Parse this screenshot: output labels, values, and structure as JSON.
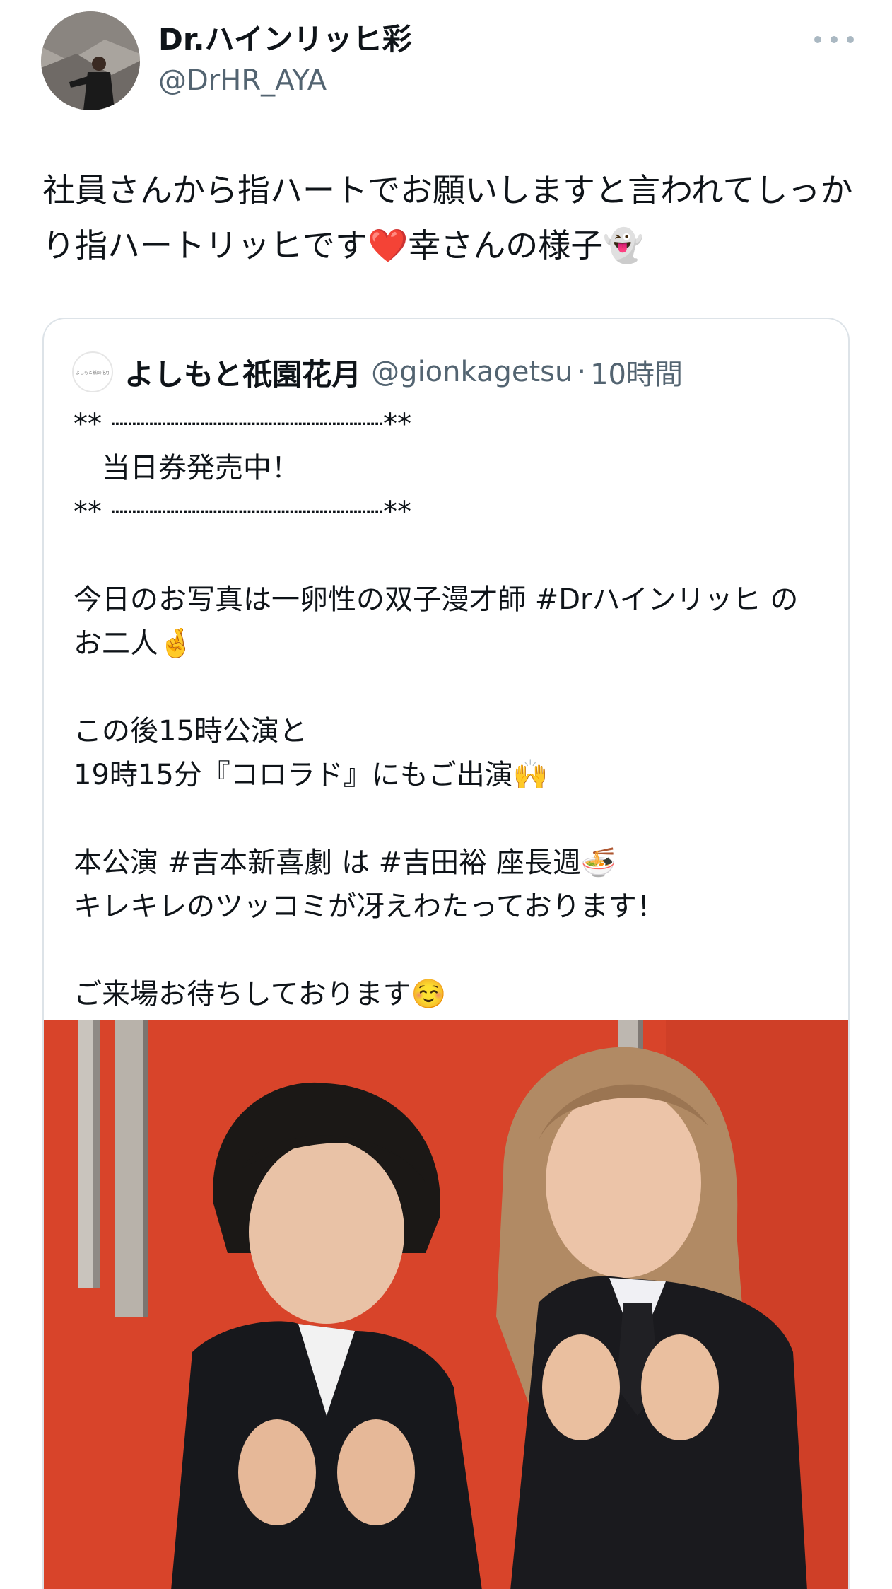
{
  "tweet": {
    "author_name": "Dr.ハインリッヒ彩",
    "author_handle": "@DrHR_AYA",
    "text": "社員さんから指ハートでお願いしますと言われてしっかり指ハートリッヒです❤️幸さんの様子👻"
  },
  "quote": {
    "avatar_text": "よしもと祇園花月",
    "author_name": "よしもと祇園花月",
    "author_handle": "@gionkagetsu",
    "separator": "·",
    "time": "10時間",
    "text": "** ┈┈┈┈┈┈┈┈┈┈┈┈┈┈┈┈**\n　当日券発売中！\n** ┈┈┈┈┈┈┈┈┈┈┈┈┈┈┈┈**\n\n今日のお写真は一卵性の双子漫才師 #Drハインリッヒ のお二人🤞\n\nこの後15時公演と\n19時15分『コロラド』にもご出演🙌\n\n本公演 #吉本新喜劇 は #吉田裕 座長週🍜\nキレキレのツッコミが冴えわたっております！\n\nご来場お待ちしております☺️"
  },
  "colors": {
    "text": "#0f1419",
    "secondary": "#536471",
    "border": "#dde3e8",
    "photo_background": "#d8442a"
  },
  "icons": {
    "more": "more-dots-icon"
  }
}
